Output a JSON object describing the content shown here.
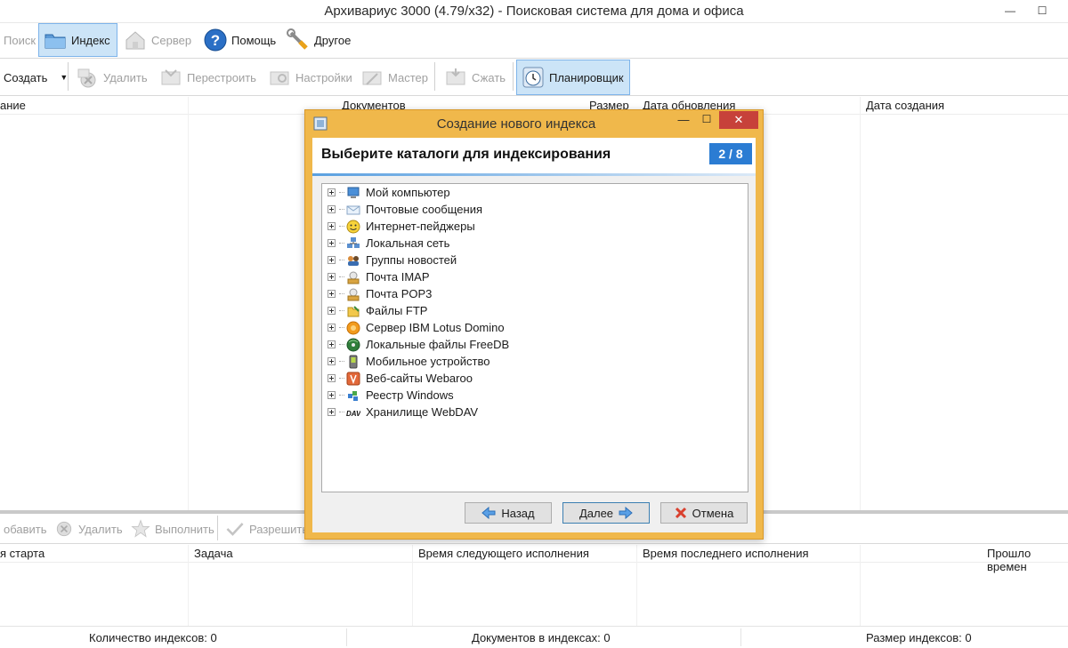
{
  "app": {
    "title": "Архивариус 3000 (4.79/x32) - Поисковая система для дома и офиса",
    "minimize": "—",
    "maximize": "☐",
    "close": "✕"
  },
  "toolbar1": {
    "search": "Поиск",
    "index": "Индекс",
    "server": "Сервер",
    "help": "Помощь",
    "other": "Другое"
  },
  "toolbar2": {
    "create": "Создать",
    "delete": "Удалить",
    "rebuild": "Перестроить",
    "settings": "Настройки",
    "wizard": "Мастер",
    "compress": "Сжать",
    "scheduler": "Планировщик"
  },
  "index_table": {
    "columns": [
      "ание",
      "Документов",
      "Размер",
      "Дата обновления",
      "Дата создания"
    ]
  },
  "toolbar3": {
    "add": "обавить",
    "delete": "Удалить",
    "execute": "Выполнить",
    "allow": "Разрешить"
  },
  "task_table": {
    "columns": [
      "я старта",
      "Задача",
      "Время следующего исполнения",
      "Время последнего исполнения",
      "Прошло времен"
    ]
  },
  "status": {
    "index_count": "Количество индексов: 0",
    "doc_count": "Документов в индексах: 0",
    "index_size": "Размер индексов: 0"
  },
  "dialog": {
    "title": "Создание нового индекса",
    "heading": "Выберите каталоги для индексирования",
    "step": "2 / 8",
    "minimize": "—",
    "maximize": "☐",
    "close": "✕",
    "tree": [
      {
        "label": "Мой компьютер",
        "icon": "computer-icon"
      },
      {
        "label": "Почтовые сообщения",
        "icon": "mail-icon"
      },
      {
        "label": "Интернет-пейджеры",
        "icon": "smiley-icon"
      },
      {
        "label": "Локальная сеть",
        "icon": "network-icon"
      },
      {
        "label": "Группы новостей",
        "icon": "newsgroups-icon"
      },
      {
        "label": "Почта IMAP",
        "icon": "imap-icon"
      },
      {
        "label": "Почта POP3",
        "icon": "pop3-icon"
      },
      {
        "label": "Файлы FTP",
        "icon": "ftp-icon"
      },
      {
        "label": "Сервер IBM Lotus Domino",
        "icon": "lotus-icon"
      },
      {
        "label": "Локальные файлы FreeDB",
        "icon": "freedb-icon"
      },
      {
        "label": "Мобильное устройство",
        "icon": "mobile-icon"
      },
      {
        "label": "Веб-сайты Webaroo",
        "icon": "webaroo-icon"
      },
      {
        "label": "Реестр Windows",
        "icon": "registry-icon"
      },
      {
        "label": "Хранилище WebDAV",
        "icon": "webdav-icon"
      }
    ],
    "back": "Назад",
    "next": "Далее",
    "cancel": "Отмена"
  },
  "colors": {
    "dialog_frame": "#f0b84b",
    "accent_blue": "#2b7cd3",
    "close_red": "#c7413a"
  }
}
